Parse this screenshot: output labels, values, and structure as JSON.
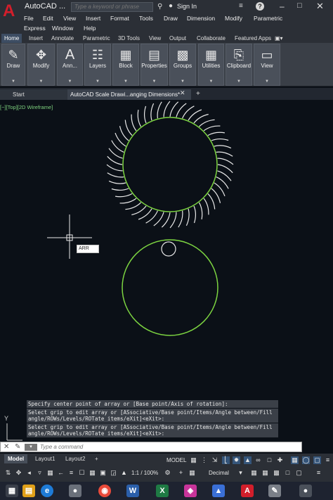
{
  "titlebar": {
    "app_title": "AutoCAD",
    "app_title_more": "...",
    "search_placeholder": "Type a keyword or phrase",
    "signin": "Sign In"
  },
  "menu": [
    "File",
    "Edit",
    "View",
    "Insert",
    "Format",
    "Tools",
    "Draw",
    "Dimension",
    "Modify",
    "Parametric",
    "Express",
    "Window",
    "Help"
  ],
  "ribbon_tabs": [
    "Home",
    "Insert",
    "Annotate",
    "Parametric",
    "3D Tools",
    "View",
    "Output",
    "Collaborate",
    "Featured Apps"
  ],
  "ribbon_panels": [
    {
      "label": "Draw",
      "icon": "pencil-icon"
    },
    {
      "label": "Modify",
      "icon": "move-icon"
    },
    {
      "label": "Ann...",
      "icon": "text-icon"
    },
    {
      "label": "Layers",
      "icon": "layers-icon"
    },
    {
      "label": "Block",
      "icon": "block-icon"
    },
    {
      "label": "Properties",
      "icon": "properties-icon"
    },
    {
      "label": "Groups",
      "icon": "groups-icon"
    },
    {
      "label": "Utilities",
      "icon": "utilities-icon"
    },
    {
      "label": "Clipboard",
      "icon": "clipboard-icon"
    },
    {
      "label": "View",
      "icon": "view-icon"
    }
  ],
  "doc_tabs": {
    "start": "Start",
    "drawing": "AutoCAD Scale Drawi...anging Dimensions*"
  },
  "viewport": {
    "label": "[−][Top][2D Wireframe]",
    "osnap_tooltip": "ARR",
    "ucs_y": "Y"
  },
  "command_history": [
    "Specify center point of array or [Base point/Axis of rotation]:",
    "Select grip to edit array or [ASsociative/Base point/Items/Angle between/Fill angle/ROWs/Levels/ROTate items/eXit]<eXit>:",
    "Select grip to edit array or [ASsociative/Base point/Items/Angle between/Fill angle/ROWs/Levels/ROTate items/eXit]<eXit>:"
  ],
  "command_input": {
    "placeholder": "Type a command"
  },
  "layout_tabs": [
    "Model",
    "Layout1",
    "Layout2"
  ],
  "statusbar": {
    "model": "MODEL",
    "scale": "1:1 / 100%",
    "units": "Decimal"
  },
  "colors": {
    "circle_green": "#7cd441",
    "blade_white": "#e8e8e8",
    "autocad_red": "#d21e2b"
  }
}
